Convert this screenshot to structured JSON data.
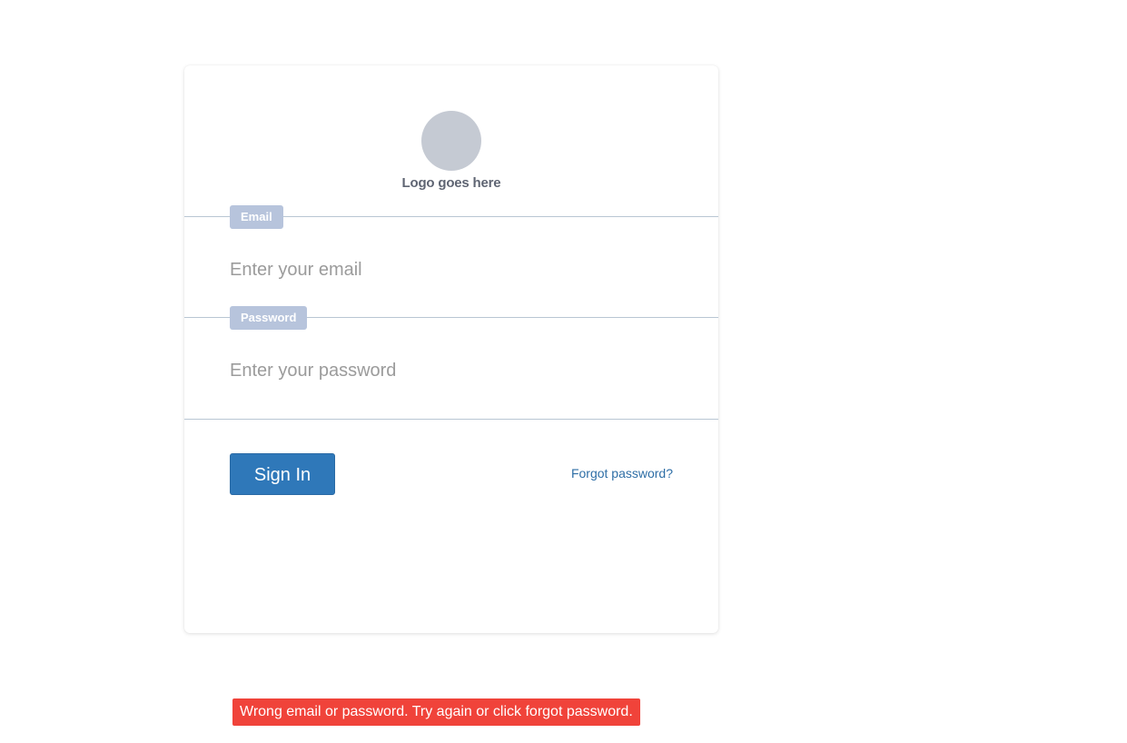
{
  "login": {
    "logo_text": "Logo goes here",
    "email": {
      "label": "Email",
      "placeholder": "Enter your email",
      "value": ""
    },
    "password": {
      "label": "Password",
      "placeholder": "Enter your password",
      "value": ""
    },
    "sign_in_label": "Sign In",
    "forgot_password_label": "Forgot password?"
  },
  "error": {
    "message": "Wrong email or password. Try again or click forgot password."
  },
  "colors": {
    "primary_button": "#2f78b9",
    "label_badge": "#b7c4dc",
    "link": "#2e6ea6",
    "error": "#f0433a",
    "logo_placeholder": "#c5cad3"
  }
}
